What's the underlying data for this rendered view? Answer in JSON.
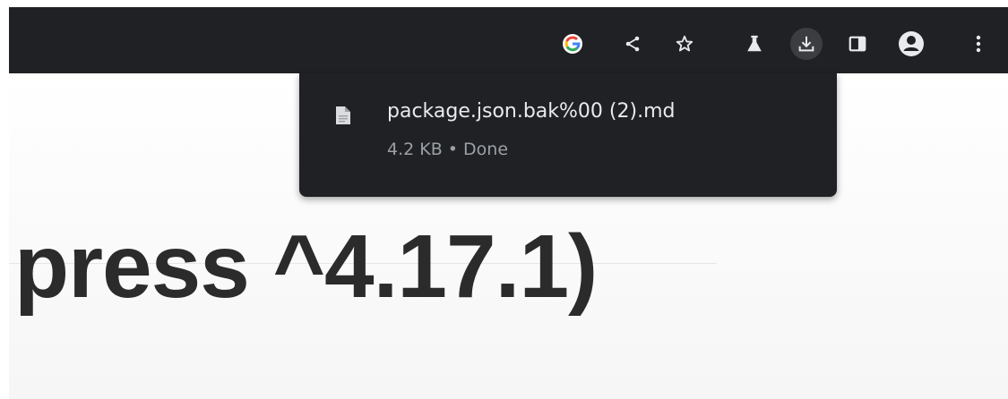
{
  "toolbar": {
    "icons": [
      {
        "name": "google-lens-icon"
      },
      {
        "name": "share-icon"
      },
      {
        "name": "bookmark-star-icon"
      },
      {
        "name": "labs-flask-icon"
      },
      {
        "name": "download-icon"
      },
      {
        "name": "side-panel-icon"
      },
      {
        "name": "profile-avatar-icon"
      },
      {
        "name": "more-menu-icon"
      }
    ],
    "colors": {
      "background": "#202124",
      "icon": "#e8eaed",
      "active_bg": "#3c3d40"
    }
  },
  "download_bubble": {
    "file_name": "package.json.bak%00 (2).md",
    "file_size": "4.2 KB",
    "separator": "•",
    "status": "Done",
    "status_line": "4.2 KB • Done"
  },
  "page": {
    "heading_text": "press ^4.17.1)"
  }
}
